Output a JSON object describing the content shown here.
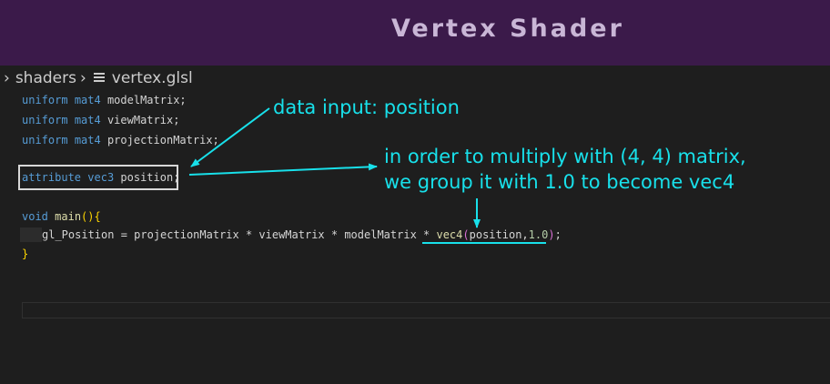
{
  "banner": {
    "title": "Vertex Shader"
  },
  "breadcrumb": {
    "folder": "shaders",
    "separator": "›",
    "file": "vertex.glsl"
  },
  "code": {
    "line1": {
      "kw1": "uniform",
      "kw2": "mat4",
      "ident": "modelMatrix;"
    },
    "line2": {
      "kw1": "uniform",
      "kw2": "mat4",
      "ident": "viewMatrix;"
    },
    "line3": {
      "kw1": "uniform",
      "kw2": "mat4",
      "ident": "projectionMatrix;"
    },
    "line4": {
      "kw1": "attribute",
      "kw2": "vec3",
      "ident": "position;"
    },
    "line5": {
      "kw": "void",
      "fn": "main",
      "paren_open": "(",
      "paren_close": ")",
      "brace": "{"
    },
    "line6": {
      "lhs": "gl_Position = projectionMatrix * viewMatrix * modelMatrix * ",
      "fn": "vec4",
      "paren_open": "(",
      "arg": "position,",
      "num": "1.0",
      "paren_close": ")",
      "semi": ";"
    },
    "line7": {
      "brace": "}"
    }
  },
  "annotations": {
    "data_input": "data input: position",
    "multiply_line1": "in order to multiply with (4, 4) matrix,",
    "multiply_line2": "we group it with 1.0 to become vec4"
  },
  "colors": {
    "banner_bg": "#3b1a4a",
    "editor_bg": "#1e1e1e",
    "annotation": "#18e0ea",
    "keyword": "#569cd6",
    "function": "#dcdcaa",
    "number": "#b5cea8"
  }
}
